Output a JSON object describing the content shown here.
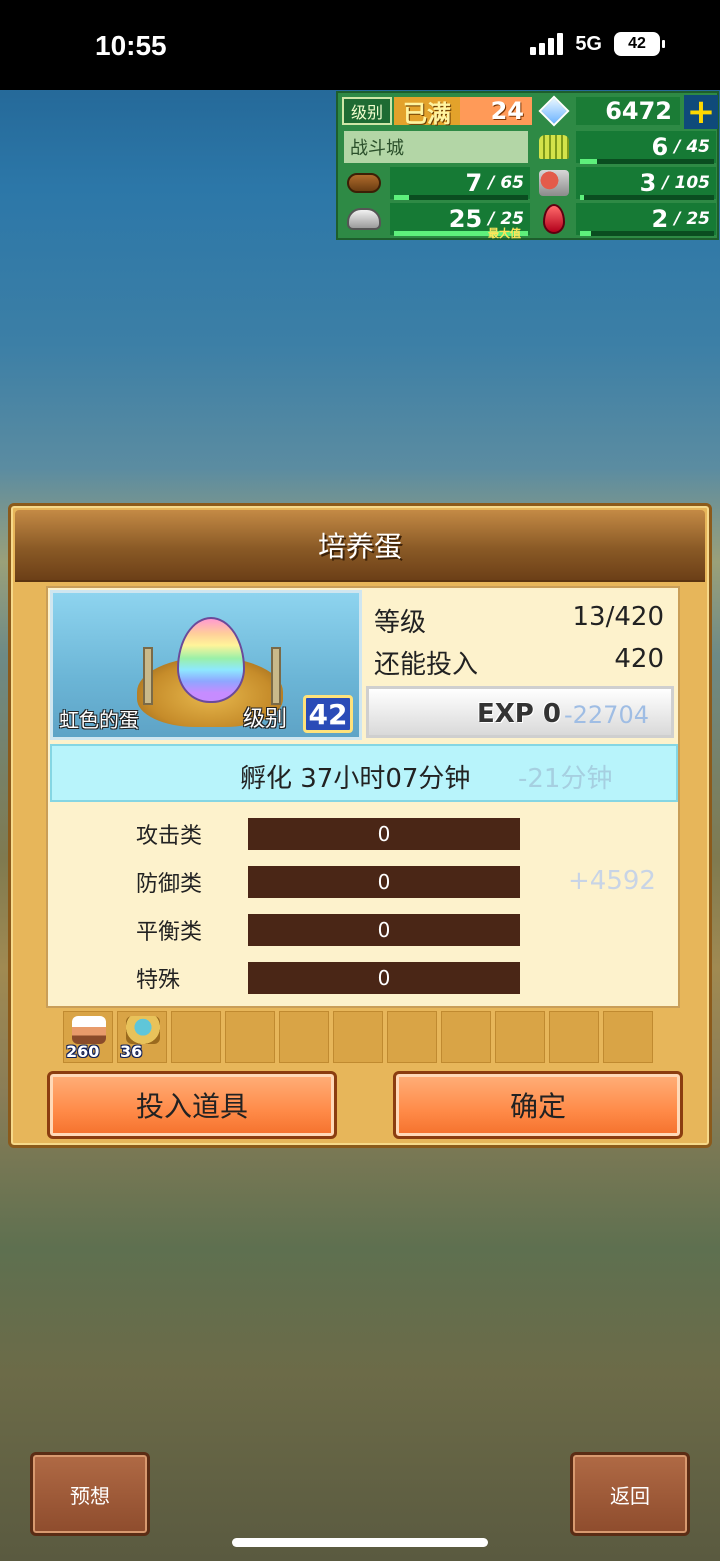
{
  "status_bar": {
    "time": "10:55",
    "network": "5G",
    "battery": "42"
  },
  "hud": {
    "level_label": "级别",
    "level_status": "已满",
    "level_value": "24",
    "gems": "6472",
    "plus": "+",
    "town_name": "战斗城",
    "resources": [
      {
        "icon": "wheat-icon",
        "value": "6",
        "max": "/ 45",
        "fill": 0.13
      },
      {
        "icon": "wood-icon",
        "value": "7",
        "max": "/ 65",
        "fill": 0.11
      },
      {
        "icon": "food-icon",
        "value": "3",
        "max": "/ 105",
        "fill": 0.03
      },
      {
        "icon": "stone-icon",
        "value": "25",
        "max": "/ 25",
        "fill": 1.0,
        "max_badge": "最大值"
      },
      {
        "icon": "ruby-icon",
        "value": "2",
        "max": "/ 25",
        "fill": 0.08
      }
    ]
  },
  "dialog": {
    "title": "培养蛋",
    "egg": {
      "name": "虹色的蛋",
      "level_label": "级别",
      "level": "42"
    },
    "stats": {
      "grade_label": "等级",
      "grade_value": "13/420",
      "remaining_label": "还能投入",
      "remaining_value": "420",
      "exp_text": "EXP 0",
      "exp_delta": "-22704"
    },
    "hatch": {
      "text": "孵化 37小时07分钟",
      "delta": "-21分钟"
    },
    "traits": [
      {
        "label": "攻击类",
        "value": "0"
      },
      {
        "label": "防御类",
        "value": "0",
        "bonus": "+4592"
      },
      {
        "label": "平衡类",
        "value": "0"
      },
      {
        "label": "特殊",
        "value": "0"
      }
    ],
    "items": [
      {
        "icon": "cake-icon",
        "count": "260"
      },
      {
        "icon": "bowl-icon",
        "count": "36"
      }
    ],
    "buttons": {
      "insert": "投入道具",
      "confirm": "确定"
    }
  },
  "footer": {
    "preview": "预想",
    "back": "返回"
  },
  "colors": {
    "accent": "#ff8a48",
    "panel": "#fdf2cc",
    "hud_green": "#167a35"
  }
}
